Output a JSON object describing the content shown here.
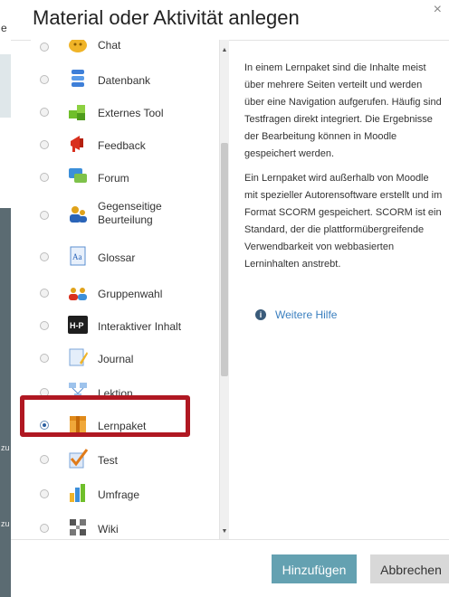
{
  "dialog": {
    "title": "Material oder Aktivität anlegen",
    "close_glyph": "×",
    "add_button": "Hinzufügen",
    "cancel_button": "Abbrechen"
  },
  "background_letters": [
    "e",
    "zu",
    "zu"
  ],
  "modules": [
    {
      "label": "Chat",
      "icon": "chat-icon",
      "selected": false
    },
    {
      "label": "Datenbank",
      "icon": "database-icon",
      "selected": false
    },
    {
      "label": "Externes Tool",
      "icon": "puzzle-icon",
      "selected": false
    },
    {
      "label": "Feedback",
      "icon": "megaphone-icon",
      "selected": false
    },
    {
      "label": "Forum",
      "icon": "forum-icon",
      "selected": false
    },
    {
      "label": "Gegenseitige Beurteilung",
      "icon": "people-icon",
      "selected": false
    },
    {
      "label": "Glossar",
      "icon": "glossary-icon",
      "selected": false
    },
    {
      "label": "Gruppenwahl",
      "icon": "group-icon",
      "selected": false
    },
    {
      "label": "Interaktiver Inhalt",
      "icon": "h5p-icon",
      "selected": false
    },
    {
      "label": "Journal",
      "icon": "journal-icon",
      "selected": false
    },
    {
      "label": "Lektion",
      "icon": "lesson-icon",
      "selected": false
    },
    {
      "label": "Lernpaket",
      "icon": "package-icon",
      "selected": true
    },
    {
      "label": "Test",
      "icon": "checkmark-icon",
      "selected": false
    },
    {
      "label": "Umfrage",
      "icon": "bar-chart-icon",
      "selected": false
    },
    {
      "label": "Wiki",
      "icon": "wiki-icon",
      "selected": false
    }
  ],
  "help": {
    "paragraph1": "In einem Lernpaket sind die Inhalte meist über mehrere Seiten verteilt und werden über eine Navigation aufgerufen. Häufig sind Testfragen direkt integriert. Die Ergebnisse der Bearbeitung können in Moodle gespeichert werden.",
    "paragraph2": "Ein Lernpaket wird außerhalb von Moodle mit spezieller Autorensoftware erstellt und im Format SCORM gespeichert. SCORM ist ein Standard, der die plattformübergreifende Verwendbarkeit von webbasierten Lerninhalten anstrebt.",
    "more_help": "Weitere Hilfe",
    "info_glyph": "i"
  },
  "colors": {
    "highlight": "#b01822",
    "primary_button": "#64a1b1",
    "link": "#3a7fbf"
  }
}
